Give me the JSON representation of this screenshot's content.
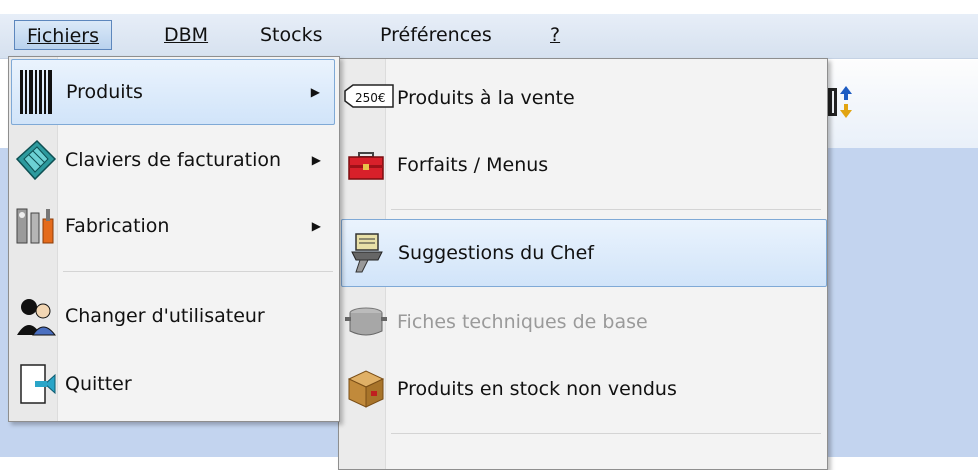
{
  "menubar": {
    "items": [
      {
        "label": "Fichiers",
        "mnemonic": "F"
      },
      {
        "label": "DBM",
        "mnemonic": "D"
      },
      {
        "label": "Stocks",
        "mnemonic": "k"
      },
      {
        "label": "Préférences",
        "mnemonic": "r"
      },
      {
        "label": "?",
        "mnemonic": "?"
      }
    ]
  },
  "file_menu": {
    "items": [
      {
        "label": "Produits",
        "icon": "barcode-icon",
        "has_submenu": true,
        "highlighted": true
      },
      {
        "label": "Claviers de facturation",
        "icon": "keyboard-icon",
        "has_submenu": true
      },
      {
        "label": "Fabrication",
        "icon": "tools-icon",
        "has_submenu": true
      },
      {
        "label": "Changer d'utilisateur",
        "icon": "users-icon"
      },
      {
        "label": "Quitter",
        "icon": "exit-door-icon"
      }
    ]
  },
  "products_submenu": {
    "items": [
      {
        "label": "Produits à la vente",
        "icon": "price-tag-icon",
        "icon_text": "250€"
      },
      {
        "label": "Forfaits / Menus",
        "icon": "toolbox-icon"
      },
      {
        "label": "Suggestions du Chef",
        "icon": "chef-notepad-icon",
        "highlighted": true
      },
      {
        "label": "Fiches techniques de base",
        "icon": "cooking-pot-icon",
        "disabled": true
      },
      {
        "label": "Produits en stock non vendus",
        "icon": "box-icon"
      }
    ]
  },
  "toolbar": {
    "icon": "sort-arrows-icon"
  },
  "colors": {
    "mdi_background": "#c3d4ef",
    "highlight_border": "#7fa9d6",
    "menu_background": "#f3f3f3"
  }
}
